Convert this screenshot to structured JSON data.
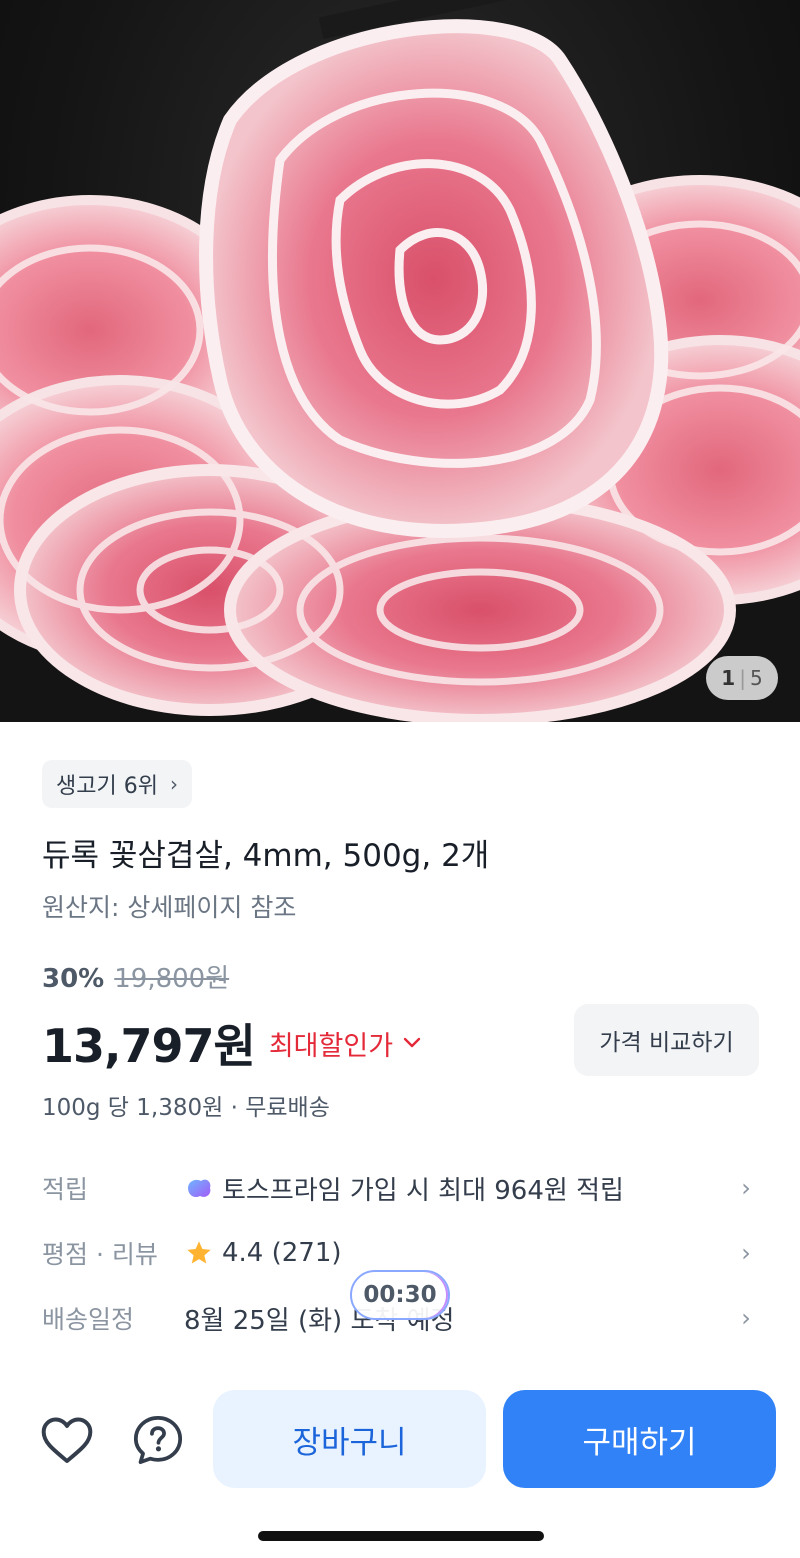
{
  "hero": {
    "image": "pork-belly-slices-photo",
    "page_current": "1",
    "page_separator": "|",
    "page_total": "5"
  },
  "product": {
    "rank_chip": "생고기 6위",
    "title": "듀록 꽃삼겹살, 4mm, 500g, 2개",
    "origin": "원산지: 상세페이지 참조",
    "discount_rate": "30%",
    "original_price": "19,800원",
    "price": "13,797원",
    "max_discount_label": "최대할인가",
    "compare_button": "가격 비교하기",
    "unit_price": "100g 당 1,380원 · 무료배송"
  },
  "info_rows": {
    "points": {
      "label": "적립",
      "value": "토스프라임 가입 시 최대 964원 적립",
      "icon": "toss-prime-icon"
    },
    "rating": {
      "label": "평점 · 리뷰",
      "value": "4.4 (271)",
      "icon": "star-icon"
    },
    "delivery": {
      "label": "배송일정",
      "value": "8월 25일 (화) 도착 예정"
    }
  },
  "timer": {
    "value": "00:30"
  },
  "bottom_bar": {
    "cart_label": "장바구니",
    "buy_label": "구매하기"
  },
  "colors": {
    "primary": "#3182f6",
    "cart_bg": "#e8f3ff",
    "discount_red": "#e42939",
    "star": "#ffb331"
  }
}
